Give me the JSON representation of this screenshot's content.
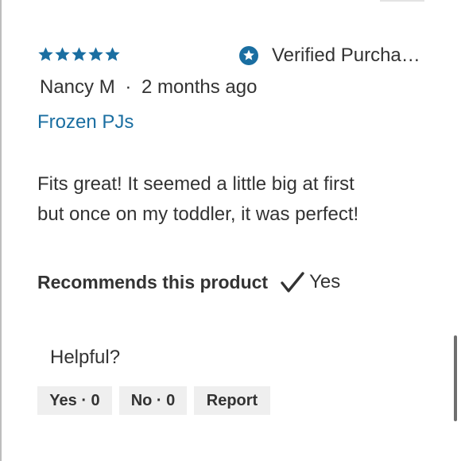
{
  "review": {
    "rating": 5,
    "rating_max": 5,
    "star_color": "#1a6ea1",
    "verified_text": "Verified Purcha…",
    "reviewer_name": "Nancy M",
    "separator": "·",
    "time_ago": "2 months ago",
    "product_name": "Frozen PJs",
    "body_line1": "Fits great! It seemed a little big at first",
    "body_line2": "but once on my toddler, it was perfect!",
    "recommend_label": "Recommends this product",
    "recommend_value": "Yes"
  },
  "helpful": {
    "label": "Helpful?",
    "yes_label": "Yes · 0",
    "no_label": "No · 0",
    "report_label": "Report"
  },
  "colors": {
    "accent": "#1a6ea1",
    "text": "#333333",
    "button_bg": "#efefef"
  },
  "icons": {
    "star": "star-icon",
    "verified": "verified-star-badge-icon",
    "check": "checkmark-icon"
  }
}
